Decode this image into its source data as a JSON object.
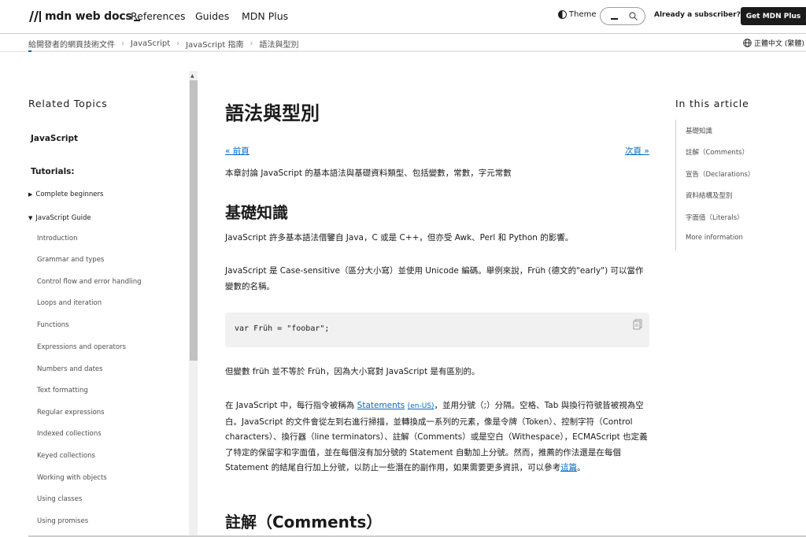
{
  "header": {
    "logo_text": "mdn web docs",
    "nav": [
      "References",
      "Guides",
      "MDN Plus"
    ],
    "theme_label": "Theme",
    "subscriber_text": "Already a subscriber?",
    "cta_label": "Get MDN Plus"
  },
  "breadcrumb": {
    "items": [
      "給開發者的網頁技術文件",
      "JavaScript",
      "JavaScript 指南",
      "語法與型別"
    ],
    "language": "正體中文 (繁體)"
  },
  "sidebar": {
    "heading": "Related Topics",
    "top_link": "JavaScript",
    "tutorials_label": "Tutorials:",
    "groups": [
      {
        "label": "Complete beginners",
        "expanded": false
      },
      {
        "label": "JavaScript Guide",
        "expanded": true
      }
    ],
    "items": [
      "Introduction",
      "Grammar and types",
      "Control flow and error handling",
      "Loops and iteration",
      "Functions",
      "Expressions and operators",
      "Numbers and dates",
      "Text formatting",
      "Regular expressions",
      "Indexed collections",
      "Keyed collections",
      "Working with objects",
      "Using classes",
      "Using promises"
    ]
  },
  "article": {
    "title": "語法與型別",
    "prev": "« 前頁",
    "next": "次頁 »",
    "intro": "本章討論 JavaScript 的基本語法與基礎資料類型、包括變數，常數，字元常數",
    "section1_title": "基礎知識",
    "p1": "JavaScript 許多基本語法借鑒自 Java，C 或是 C++，但亦受 Awk、Perl 和 Python 的影響。",
    "p2": "JavaScript 是 Case-sensitive（區分大小寫）並使用 Unicode 編碼。舉例來說，Früh (德文的\"early\") 可以當作變數的名稱。",
    "code": "var Früh = \"foobar\";",
    "p3": "但變數 früh 並不等於 Früh，因為大小寫對 JavaScript 是有區別的。",
    "p4_before": "在 JavaScript 中，每行指令被稱為 ",
    "p4_link": "Statements",
    "p4_link_small": "(en-US)",
    "p4_after": "，並用分號（;）分隔。空格、Tab 與換行符號皆被視為空白。JavaScript 的文件會從左到右進行掃描，並轉換成一系列的元素，像是令牌（Token）、控制字符（Control characters）、換行器（line terminators）、註解（Comments）或是空白（Withespace），ECMAScript 也定義了特定的保留字和字面值，並在每個沒有加分號的 Statement 自動加上分號。然而，推薦的作法還是在每個 Statement 的結尾自行加上分號，以防止一些潛在的副作用，如果需要更多資訊，可以參考",
    "p4_link2": "這篇",
    "p4_end": "。",
    "section2_title": "註解（Comments）"
  },
  "toc": {
    "heading": "In this article",
    "items": [
      "基礎知識",
      "註解（Comments）",
      "宣告（Declarations）",
      "資料結構及型別",
      "字面值（Literals）",
      "More information"
    ]
  },
  "colors": {
    "link": "#0069c2",
    "cta_bg": "#1b1b1b",
    "code_bg": "#f2f1f1"
  }
}
